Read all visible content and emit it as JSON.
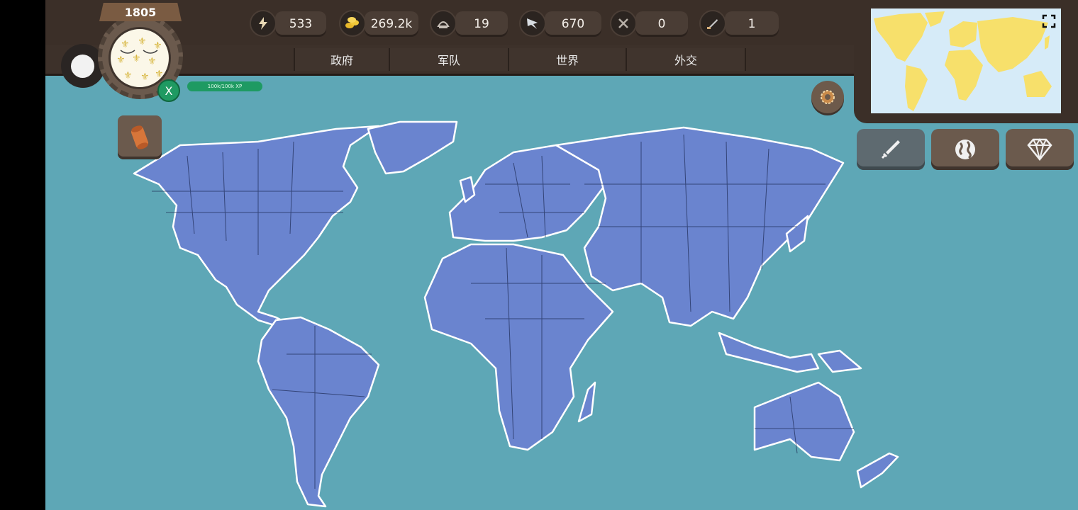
{
  "header": {
    "year": "1805",
    "resources": [
      {
        "icon": "lightning-icon",
        "value": "533"
      },
      {
        "icon": "gold-coins-icon",
        "value": "269.2k"
      },
      {
        "icon": "manpower-icon",
        "value": "19"
      },
      {
        "icon": "eagle-icon",
        "value": "670"
      },
      {
        "icon": "crossed-swords-icon",
        "value": "0"
      },
      {
        "icon": "ship-icon",
        "value": "1"
      }
    ],
    "tabs": [
      "政府",
      "军队",
      "世界",
      "外交"
    ]
  },
  "player": {
    "close_label": "X",
    "xp_text": "100k/100k XP",
    "flag_icon": "fleur-de-lis-flag-icon"
  },
  "colors": {
    "ocean": "#5ea7b6",
    "land": "#6a84cf",
    "minimap_land": "#f7e06b",
    "ui_brown": "#3b2f28",
    "xp_green": "#1e9a62"
  },
  "right_buttons": [
    {
      "icon": "sword-icon"
    },
    {
      "icon": "globe-icon"
    },
    {
      "icon": "diamond-icon"
    }
  ]
}
